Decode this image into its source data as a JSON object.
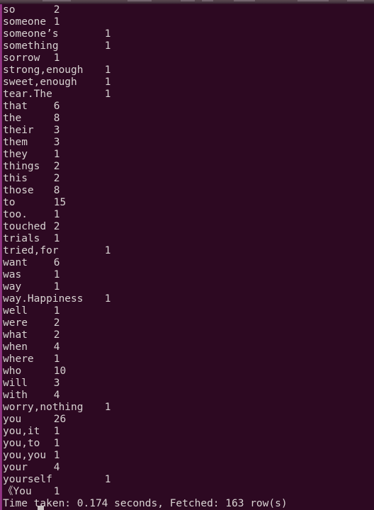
{
  "terminal": {
    "background_color": "#2D0922",
    "foreground_color": "#D8D3D2",
    "scrollbar_color": "#a6399a",
    "titlebar_color": "#4a3a44",
    "rows": [
      {
        "word": "so",
        "count": "2",
        "tab": 8
      },
      {
        "word": "someone",
        "count": "1",
        "tab": 8
      },
      {
        "word": "someone’s",
        "count": "1",
        "tab": 16
      },
      {
        "word": "something",
        "count": "1",
        "tab": 16
      },
      {
        "word": "sorrow",
        "count": "1",
        "tab": 8
      },
      {
        "word": "strong,enough",
        "count": "1",
        "tab": 16
      },
      {
        "word": "sweet,enough",
        "count": "1",
        "tab": 16
      },
      {
        "word": "tear.The",
        "count": "1",
        "tab": 16
      },
      {
        "word": "that",
        "count": "6",
        "tab": 8
      },
      {
        "word": "the",
        "count": "8",
        "tab": 8
      },
      {
        "word": "their",
        "count": "3",
        "tab": 8
      },
      {
        "word": "them",
        "count": "3",
        "tab": 8
      },
      {
        "word": "they",
        "count": "1",
        "tab": 8
      },
      {
        "word": "things",
        "count": "2",
        "tab": 8
      },
      {
        "word": "this",
        "count": "2",
        "tab": 8
      },
      {
        "word": "those",
        "count": "8",
        "tab": 8
      },
      {
        "word": "to",
        "count": "15",
        "tab": 8
      },
      {
        "word": "too.",
        "count": "1",
        "tab": 8
      },
      {
        "word": "touched",
        "count": "2",
        "tab": 8
      },
      {
        "word": "trials",
        "count": "1",
        "tab": 8
      },
      {
        "word": "tried,for",
        "count": "1",
        "tab": 16
      },
      {
        "word": "want",
        "count": "6",
        "tab": 8
      },
      {
        "word": "was",
        "count": "1",
        "tab": 8
      },
      {
        "word": "way",
        "count": "1",
        "tab": 8
      },
      {
        "word": "way.Happiness",
        "count": "1",
        "tab": 16
      },
      {
        "word": "well",
        "count": "1",
        "tab": 8
      },
      {
        "word": "were",
        "count": "2",
        "tab": 8
      },
      {
        "word": "what",
        "count": "2",
        "tab": 8
      },
      {
        "word": "when",
        "count": "4",
        "tab": 8
      },
      {
        "word": "where",
        "count": "1",
        "tab": 8
      },
      {
        "word": "who",
        "count": "10",
        "tab": 8
      },
      {
        "word": "will",
        "count": "3",
        "tab": 8
      },
      {
        "word": "with",
        "count": "4",
        "tab": 8
      },
      {
        "word": "worry,nothing",
        "count": "1",
        "tab": 16
      },
      {
        "word": "you",
        "count": "26",
        "tab": 8
      },
      {
        "word": "you,it",
        "count": "1",
        "tab": 8
      },
      {
        "word": "you,to",
        "count": "1",
        "tab": 8
      },
      {
        "word": "you,you",
        "count": "1",
        "tab": 8
      },
      {
        "word": "your",
        "count": "4",
        "tab": 8
      },
      {
        "word": "yourself",
        "count": "1",
        "tab": 16
      },
      {
        "word": "《You",
        "count": "1",
        "tab": 8
      }
    ],
    "status_line": "Time taken: 0.174 seconds, Fetched: 163 row(s)",
    "time_taken_seconds": "0.174",
    "fetched_rows": "163"
  }
}
